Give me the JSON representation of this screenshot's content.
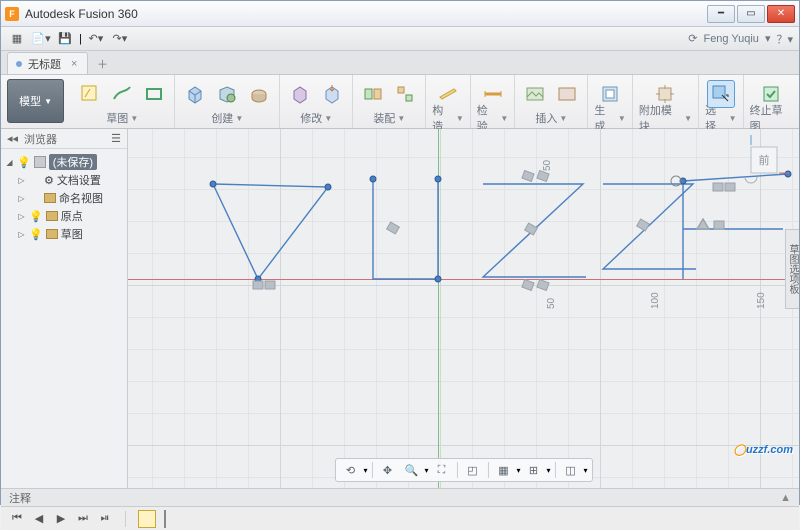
{
  "app": {
    "title": "Autodesk Fusion 360",
    "user": "Feng Yuqiu"
  },
  "tabs": {
    "doc": "无标题",
    "close": "×",
    "plus": "＋"
  },
  "ribbon": {
    "model": "模型",
    "groups": [
      {
        "label": "草图",
        "icons": [
          "sketch",
          "line",
          "spline"
        ]
      },
      {
        "label": "创建",
        "icons": [
          "box",
          "cyl",
          "sphere"
        ]
      },
      {
        "label": "修改",
        "icons": [
          "fillet",
          "press"
        ]
      },
      {
        "label": "装配",
        "icons": [
          "asm1",
          "asm2"
        ]
      },
      {
        "label": "构造",
        "icons": [
          "plane"
        ]
      },
      {
        "label": "检验",
        "icons": [
          "meas"
        ]
      },
      {
        "label": "插入",
        "icons": [
          "img",
          "decal"
        ]
      },
      {
        "label": "生成",
        "icons": [
          "make"
        ]
      },
      {
        "label": "附加模块",
        "icons": [
          "addin"
        ]
      },
      {
        "label": "选择",
        "icons": [
          "sel"
        ]
      },
      {
        "label": "终止草图",
        "icons": [
          "stop"
        ]
      }
    ]
  },
  "browser": {
    "header": "浏览器",
    "root": "(未保存)",
    "items": [
      {
        "label": "文档设置"
      },
      {
        "label": "命名视图"
      },
      {
        "label": "原点"
      },
      {
        "label": "草图"
      }
    ]
  },
  "canvas": {
    "ticks": [
      "50",
      "50",
      "100",
      "150"
    ]
  },
  "footer": {
    "comment": "注释"
  },
  "timeline": {
    "buttons": [
      "⏮",
      "◀",
      "▶",
      "⏭",
      "⏯"
    ]
  },
  "watermark": "uzzf.com"
}
